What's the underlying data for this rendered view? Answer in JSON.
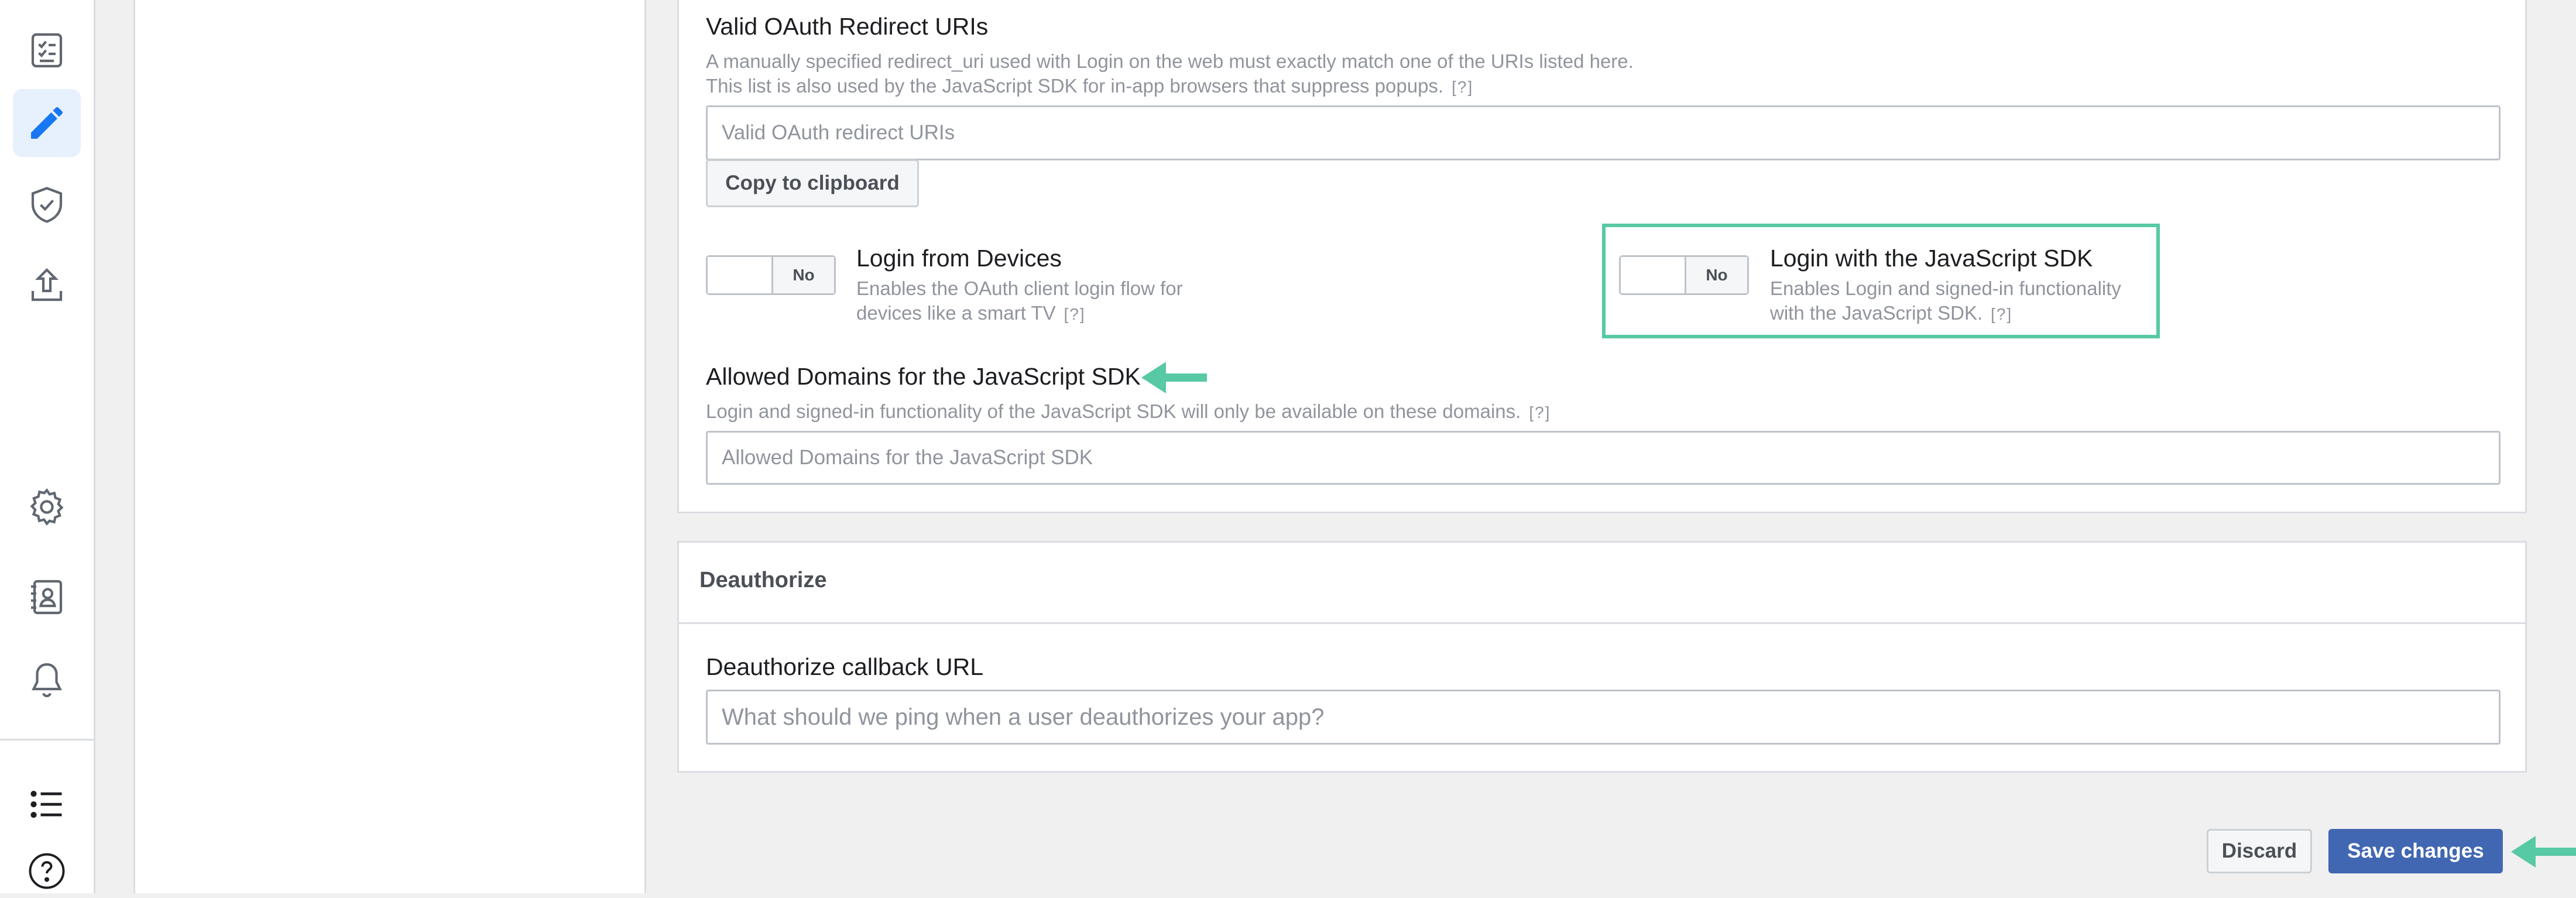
{
  "sidebar": {
    "items": [
      {
        "icon": "checklist-icon",
        "active": false
      },
      {
        "icon": "pencil-icon",
        "active": true
      },
      {
        "icon": "shield-check-icon",
        "active": false
      },
      {
        "icon": "upload-icon",
        "active": false
      },
      {
        "icon": "gear-icon",
        "active": false
      },
      {
        "icon": "contact-card-icon",
        "active": false
      },
      {
        "icon": "bell-icon",
        "active": false
      },
      {
        "icon": "list-icon",
        "active": false
      },
      {
        "icon": "help-icon",
        "active": false
      }
    ]
  },
  "oauth": {
    "redirect_label": "Valid OAuth Redirect URIs",
    "redirect_desc_1": "A manually specified redirect_uri used with Login on the web must exactly match one of the URIs listed here.",
    "redirect_desc_2": "This list is also used by the JavaScript SDK for in-app browsers that suppress popups.",
    "help": "[?]",
    "redirect_placeholder": "Valid OAuth redirect URIs",
    "copy_button": "Copy to clipboard",
    "devices_toggle_state": "No",
    "devices_title": "Login from Devices",
    "devices_desc_1": "Enables the OAuth client login flow for",
    "devices_desc_2": "devices like a smart TV",
    "jssdk_toggle_state": "No",
    "jssdk_title": "Login with the JavaScript SDK",
    "jssdk_desc_1": "Enables Login and signed-in functionality",
    "jssdk_desc_2": "with the JavaScript SDK.",
    "domains_label": "Allowed Domains for the JavaScript SDK",
    "domains_desc": "Login and signed-in functionality of the JavaScript SDK will only be available on these domains.",
    "domains_placeholder": "Allowed Domains for the JavaScript SDK"
  },
  "deauthorize": {
    "title": "Deauthorize",
    "callback_label": "Deauthorize callback URL",
    "callback_placeholder": "What should we ping when a user deauthorizes your app?"
  },
  "footer": {
    "discard": "Discard",
    "save": "Save changes"
  },
  "colors": {
    "accent_arrow": "#57c9a4",
    "primary": "#4267b2",
    "active_icon": "#1877f2"
  }
}
